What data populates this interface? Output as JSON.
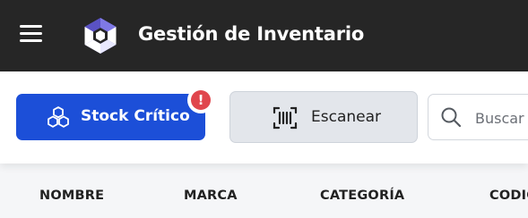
{
  "header": {
    "title": "Gestión de Inventario",
    "menu_icon": "hamburger-menu-icon",
    "logo_icon": "hexagon-logo-icon"
  },
  "toolbar": {
    "stock_button": {
      "label": "Stock Crítico",
      "icon": "cubes-icon",
      "badge": "!"
    },
    "scan_button": {
      "label": "Escanear",
      "icon": "barcode-scan-icon"
    },
    "search": {
      "placeholder": "Buscar",
      "value": "",
      "icon": "search-icon"
    }
  },
  "table": {
    "columns": [
      "NOMBRE",
      "MARCA",
      "CATEGORÍA",
      "CODIGO"
    ]
  },
  "colors": {
    "topbar": "#262626",
    "primary": "#1c4fd8",
    "alert": "#e0464d",
    "secondary_button": "#e3e6eb"
  }
}
